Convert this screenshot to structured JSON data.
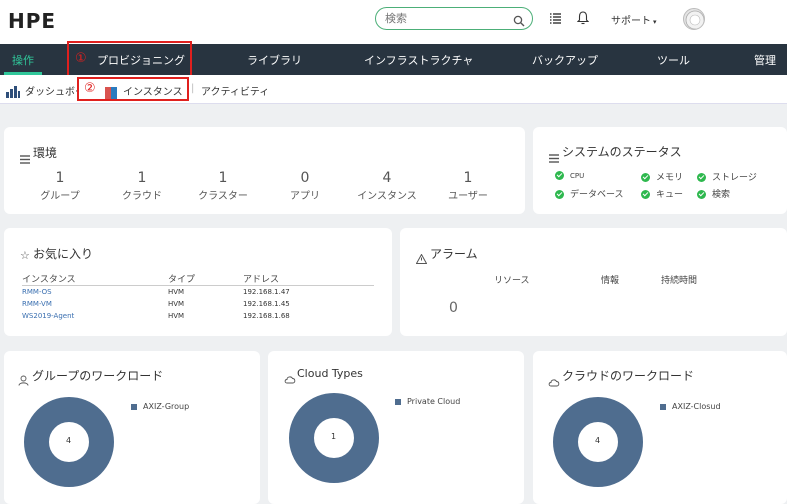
{
  "brand": "HPE",
  "search": {
    "placeholder": "検索"
  },
  "header": {
    "support": "サポート"
  },
  "nav": {
    "items": [
      "操作",
      "プロビジョニング",
      "ライブラリ",
      "インフラストラクチャ",
      "バックアップ",
      "ツール",
      "管理"
    ],
    "active": "操作"
  },
  "subnav": {
    "items": [
      "ダッシュボード",
      "インスタンス",
      "アクティビティ"
    ]
  },
  "annotations": {
    "one": "①",
    "two": "②"
  },
  "environment": {
    "title": "環境",
    "stats": [
      {
        "value": "1",
        "label": "グループ"
      },
      {
        "value": "1",
        "label": "クラウド"
      },
      {
        "value": "1",
        "label": "クラスター"
      },
      {
        "value": "0",
        "label": "アプリ"
      },
      {
        "value": "4",
        "label": "インスタンス"
      },
      {
        "value": "1",
        "label": "ユーザー"
      }
    ]
  },
  "system_status": {
    "title": "システムのステータス",
    "items": [
      "CPU",
      "メモリ",
      "ストレージ",
      "データベース",
      "キュー",
      "検索"
    ]
  },
  "favorites": {
    "title": "お気に入り",
    "columns": [
      "インスタンス",
      "タイプ",
      "アドレス"
    ],
    "rows": [
      [
        "RMM-OS",
        "HVM",
        "192.168.1.47"
      ],
      [
        "RMM-VM",
        "HVM",
        "192.168.1.45"
      ],
      [
        "WS2019-Agent",
        "HVM",
        "192.168.1.68"
      ]
    ]
  },
  "alarms": {
    "title": "アラーム",
    "columns": [
      "リソース",
      "情報",
      "持続時間"
    ],
    "count": "0"
  },
  "group_workload": {
    "title": "グループのワークロード",
    "legend": "AXIZ-Group",
    "value": "4"
  },
  "cloud_types": {
    "title": "Cloud Types",
    "legend": "Private Cloud",
    "value": "1"
  },
  "cloud_workload": {
    "title": "クラウドのワークロード",
    "legend": "AXIZ-Closud",
    "value": "4"
  },
  "colors": {
    "accent": "#30c79a",
    "nav_bg": "#283440",
    "donut": "#4f6d8f",
    "highlight": "#e0201e"
  }
}
